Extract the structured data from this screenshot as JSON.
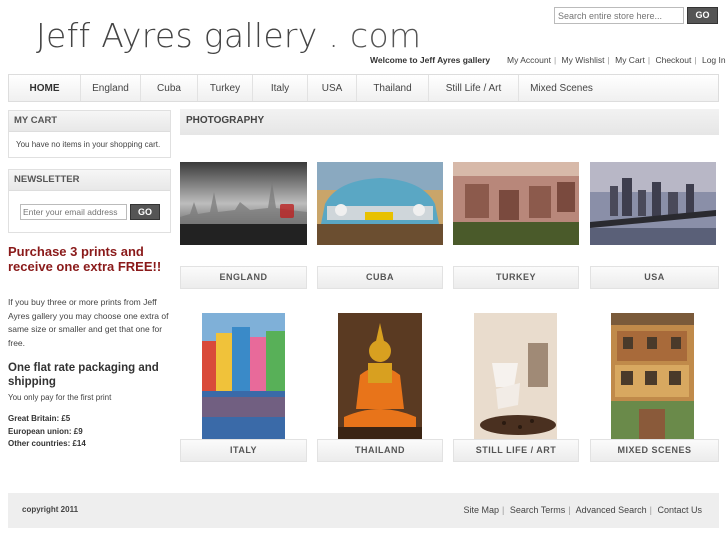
{
  "logo": {
    "name": "Jeff Ayres gallery",
    "domain": ". com"
  },
  "search": {
    "placeholder": "Search entire store here...",
    "button": "GO"
  },
  "header": {
    "welcome": "Welcome to Jeff Ayres gallery",
    "links": [
      "My Account",
      "My Wishlist",
      "My Cart",
      "Checkout",
      "Log In"
    ]
  },
  "nav": [
    "HOME",
    "England",
    "Cuba",
    "Turkey",
    "Italy",
    "USA",
    "Thailand",
    "Still Life / Art",
    "Mixed Scenes"
  ],
  "cart": {
    "title": "MY CART",
    "empty": "You have no items in your shopping cart."
  },
  "newsletter": {
    "title": "NEWSLETTER",
    "placeholder": "Enter your email address",
    "button": "GO"
  },
  "promo": {
    "headline": "Purchase 3 prints and receive one extra FREE!!",
    "text": "If you buy three or more prints from Jeff Ayres gallery you may choose one extra of same size or smaller and get that one for free."
  },
  "shipping": {
    "headline": "One flat rate packaging and shipping",
    "note": "You only pay for the first print",
    "rates": [
      "Great Britain: £5",
      "European union: £9",
      "Other countries: £14"
    ]
  },
  "section": {
    "title": "PHOTOGRAPHY"
  },
  "categories": [
    "ENGLAND",
    "CUBA",
    "TURKEY",
    "USA",
    "ITALY",
    "THAILAND",
    "STILL LIFE / ART",
    "MIXED SCENES"
  ],
  "footer": {
    "copyright": "copyright 2011",
    "links": [
      "Site Map",
      "Search Terms",
      "Advanced Search",
      "Contact Us"
    ]
  }
}
